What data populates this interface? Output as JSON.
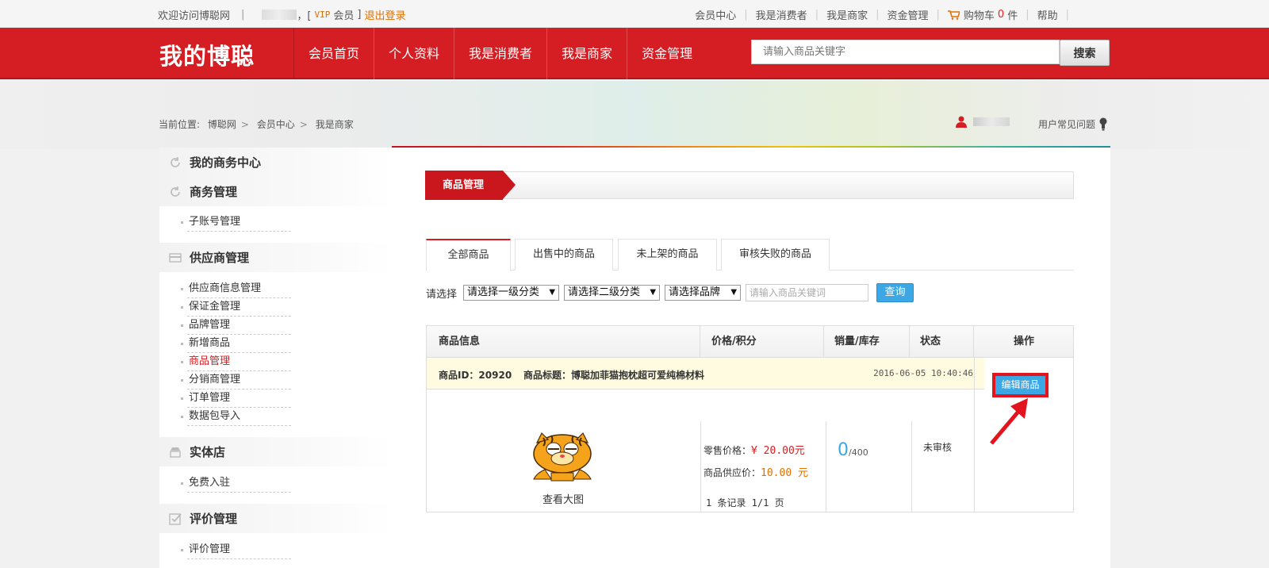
{
  "topbar": {
    "welcome": "欢迎访问博聪网",
    "bracket_open": "，[",
    "vip": "VIP",
    "member": "会员",
    "bracket_close": "]",
    "logout": "退出登录",
    "links": [
      "会员中心",
      "我是消费者",
      "我是商家",
      "资金管理"
    ],
    "cart_label": "购物车",
    "cart_count": "0",
    "cart_unit": "件",
    "help": "帮助"
  },
  "header": {
    "logo": "我的博聪",
    "nav": [
      "会员首页",
      "个人资料",
      "我是消费者",
      "我是商家",
      "资金管理"
    ],
    "search_placeholder": "请输入商品关键字",
    "search_button": "搜索"
  },
  "breadcrumb": {
    "label": "当前位置:",
    "items": [
      "博聪网",
      "会员中心",
      "我是商家"
    ]
  },
  "faq": "用户常见问题",
  "sidebar": {
    "sections": [
      {
        "title": "我的商务中心",
        "icon": "refresh-icon",
        "items": []
      },
      {
        "title": "商务管理",
        "icon": "refresh-icon",
        "items": [
          "子账号管理"
        ]
      },
      {
        "title": "供应商管理",
        "icon": "card-icon",
        "items": [
          "供应商信息管理",
          "保证金管理",
          "品牌管理",
          "新增商品",
          "商品管理",
          "分销商管理",
          "订单管理",
          "数据包导入"
        ]
      },
      {
        "title": "实体店",
        "icon": "store-icon",
        "items": [
          "免费入驻"
        ]
      },
      {
        "title": "评价管理",
        "icon": "check-icon",
        "items": [
          "评价管理"
        ]
      }
    ],
    "active_item": "商品管理"
  },
  "main": {
    "title": "商品管理",
    "tabs": [
      "全部商品",
      "出售中的商品",
      "未上架的商品",
      "审核失败的商品"
    ],
    "active_tab": "全部商品",
    "filter": {
      "label": "请选择",
      "category1": "请选择一级分类",
      "category2": "请选择二级分类",
      "brand": "请选择品牌",
      "keyword_placeholder": "请输入商品关键词",
      "query_button": "查询"
    },
    "table": {
      "headers": [
        "商品信息",
        "价格/积分",
        "销量/库存",
        "状态",
        "操作"
      ],
      "rows": [
        {
          "product_id": "商品ID：20920",
          "title": "商品标题：博聪加菲猫抱枕超可爱纯棉材料",
          "date": "2016-06-05 10:40:46",
          "view_large": "查看大图",
          "retail_label": "零售价格：",
          "retail_price": "¥ 20.00元",
          "supply_label": "商品供应价：",
          "supply_price": "10.00 元",
          "sold": "0",
          "stock": "/400",
          "status": "未审核",
          "action": "编辑商品"
        }
      ]
    },
    "pager": "1 条记录 1/1 页"
  },
  "colors": {
    "brand_red": "#d41e23",
    "accent_blue": "#3ca7e5",
    "orange": "#e07000"
  }
}
